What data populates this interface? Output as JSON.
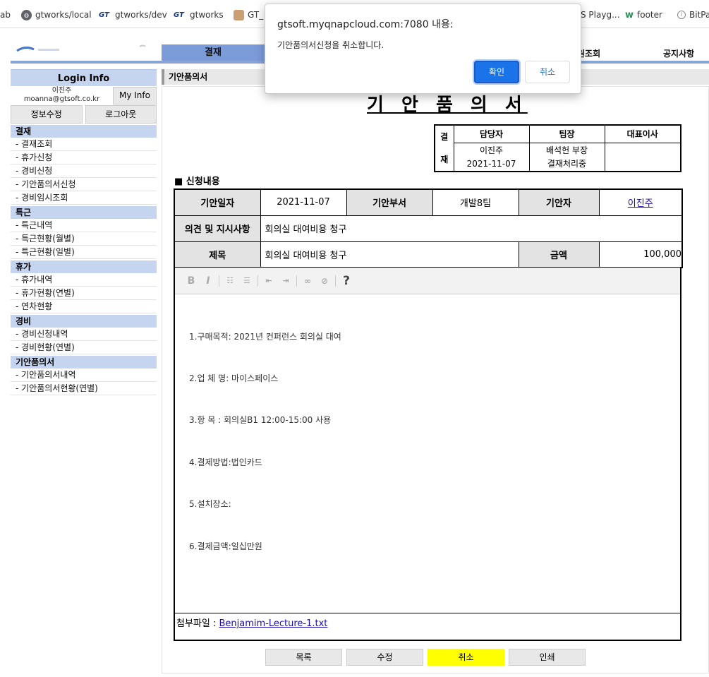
{
  "bookmarks": [
    {
      "label": "ab",
      "icon": "none"
    },
    {
      "label": "gtworks/local",
      "icon": "globe-icon"
    },
    {
      "label": "gtworks/dev",
      "icon": "gt-logo-icon"
    },
    {
      "label": "gtworks",
      "icon": "gt-logo-icon"
    },
    {
      "label": "GT_",
      "icon": "avatar-icon"
    },
    {
      "label": "S Playg...",
      "icon": "none"
    },
    {
      "label": "footer",
      "icon": "w3-icon"
    },
    {
      "label": "BitPa",
      "icon": "info-circle-icon"
    }
  ],
  "nav": {
    "active": "결재",
    "items": [
      "원조회",
      "공지사항"
    ]
  },
  "sidebar": {
    "login_title": "Login Info",
    "user_name": "이진주",
    "user_email": "moanna@gtsoft.co.kr",
    "myinfo_label": "My Info",
    "edit_label": "정보수정",
    "logout_label": "로그아웃",
    "groups": [
      {
        "title": "결재",
        "items": [
          "- 결재조회",
          "- 휴가신청",
          "- 경비신청",
          "- 기안품의서신청",
          "- 경비임시조회"
        ]
      },
      {
        "title": "특근",
        "items": [
          "- 특근내역",
          "- 특근현황(월별)",
          "- 특근현황(일별)"
        ]
      },
      {
        "title": "휴가",
        "items": [
          "- 휴가내역",
          "- 휴가현황(연별)",
          "- 연차현황"
        ]
      },
      {
        "title": "경비",
        "items": [
          "- 경비신청내역",
          "- 경비현황(연별)"
        ]
      },
      {
        "title": "기안품의서",
        "items": [
          "- 기안품의서내역",
          "- 기안품의서현황(연별)"
        ]
      }
    ]
  },
  "main": {
    "section_title": "기안품의서",
    "doc_title": "기 안 품 의 서",
    "approval": {
      "side_top": "결",
      "side_bottom": "재",
      "headers": [
        "담당자",
        "팀장",
        "대표이사"
      ],
      "c1_name": "이진주",
      "c1_date": "2021-11-07",
      "c2_name": "배석헌 부장",
      "c2_status": "결재처리중",
      "c3": ""
    },
    "request_title": "■ 신청내용",
    "labels": {
      "date": "기안일자",
      "dept": "기안부서",
      "drafter": "기안자",
      "opinion": "의견 및 지시사항",
      "subject": "제목",
      "amount": "금액"
    },
    "values": {
      "date": "2021-11-07",
      "dept": "개발8팀",
      "drafter": "이진주",
      "opinion": "회의실 대여비용 청구",
      "subject": "회의실 대여비용 청구",
      "amount": "100,000"
    },
    "content_lines": [
      "1.구매목적: 2021년 컨퍼런스 회의실 대여",
      "2.업 체 명: 마이스페이스",
      "3.항 목 : 회의실B1 12:00-15:00 사용",
      "4.결제방법:법인카드",
      "5.설치장소:",
      "6.결제금액:일십만원"
    ],
    "attachment_label": "첨부파일 :",
    "attachment_file": "Benjamim-Lecture-1.txt"
  },
  "buttons": {
    "list": "목록",
    "edit": "수정",
    "cancel": "취소",
    "print": "인쇄"
  },
  "dialog": {
    "title": "gtsoft.myqnapcloud.com:7080 내용:",
    "message": "기안품의서신청을 취소합니다.",
    "ok": "확인",
    "cancel": "취소"
  },
  "colors": {
    "nav_active": "#7c9bd9",
    "sidebar_head": "#c5d4ef",
    "dialog_ok": "#1a73e8",
    "highlight": "#ffff00"
  }
}
